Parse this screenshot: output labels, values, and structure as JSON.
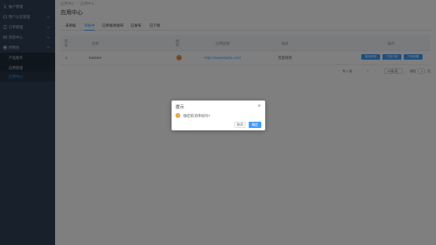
{
  "sidebar": {
    "items": [
      {
        "label": "账户管理",
        "icon": "user-icon"
      },
      {
        "label": "用户认证管理",
        "icon": "id-card-icon"
      },
      {
        "label": "订单管理",
        "icon": "order-icon"
      },
      {
        "label": "消息中心",
        "icon": "message-icon"
      },
      {
        "label": "控制台",
        "icon": "dashboard-icon"
      }
    ],
    "subitems": [
      {
        "label": "产品服务"
      },
      {
        "label": "应用管理"
      },
      {
        "label": "应用中心"
      }
    ]
  },
  "breadcrumb": {
    "parent": "应用中心",
    "current": "应用中心"
  },
  "page": {
    "title": "应用中心"
  },
  "tabs": [
    {
      "label": "未审核"
    },
    {
      "label": "审核中"
    },
    {
      "label": "已审核待发布"
    },
    {
      "label": "已发布"
    },
    {
      "label": "已下架"
    }
  ],
  "table": {
    "headers": {
      "no": "序号",
      "name": "名称",
      "icon": "图标",
      "link": "应用链接",
      "desc": "描述",
      "ops": "操作"
    },
    "rows": [
      {
        "no": "1",
        "name": "baiduhe",
        "link": "https://www.baidu.com/",
        "desc": "百度链接",
        "ops": [
          "取消审核",
          "产品介绍",
          "产品配置"
        ]
      }
    ]
  },
  "pager": {
    "total": "共 1 条",
    "page": "1",
    "size": "10条/页",
    "goto": "前往",
    "goto_page": "1",
    "unit": "页"
  },
  "dialog": {
    "title": "提示",
    "message": "确定取消审核吗?",
    "cancel": "取消",
    "confirm": "确定"
  },
  "colors": {
    "primary": "#409eff",
    "warning": "#e6a23c",
    "sidebar": "#304156"
  }
}
